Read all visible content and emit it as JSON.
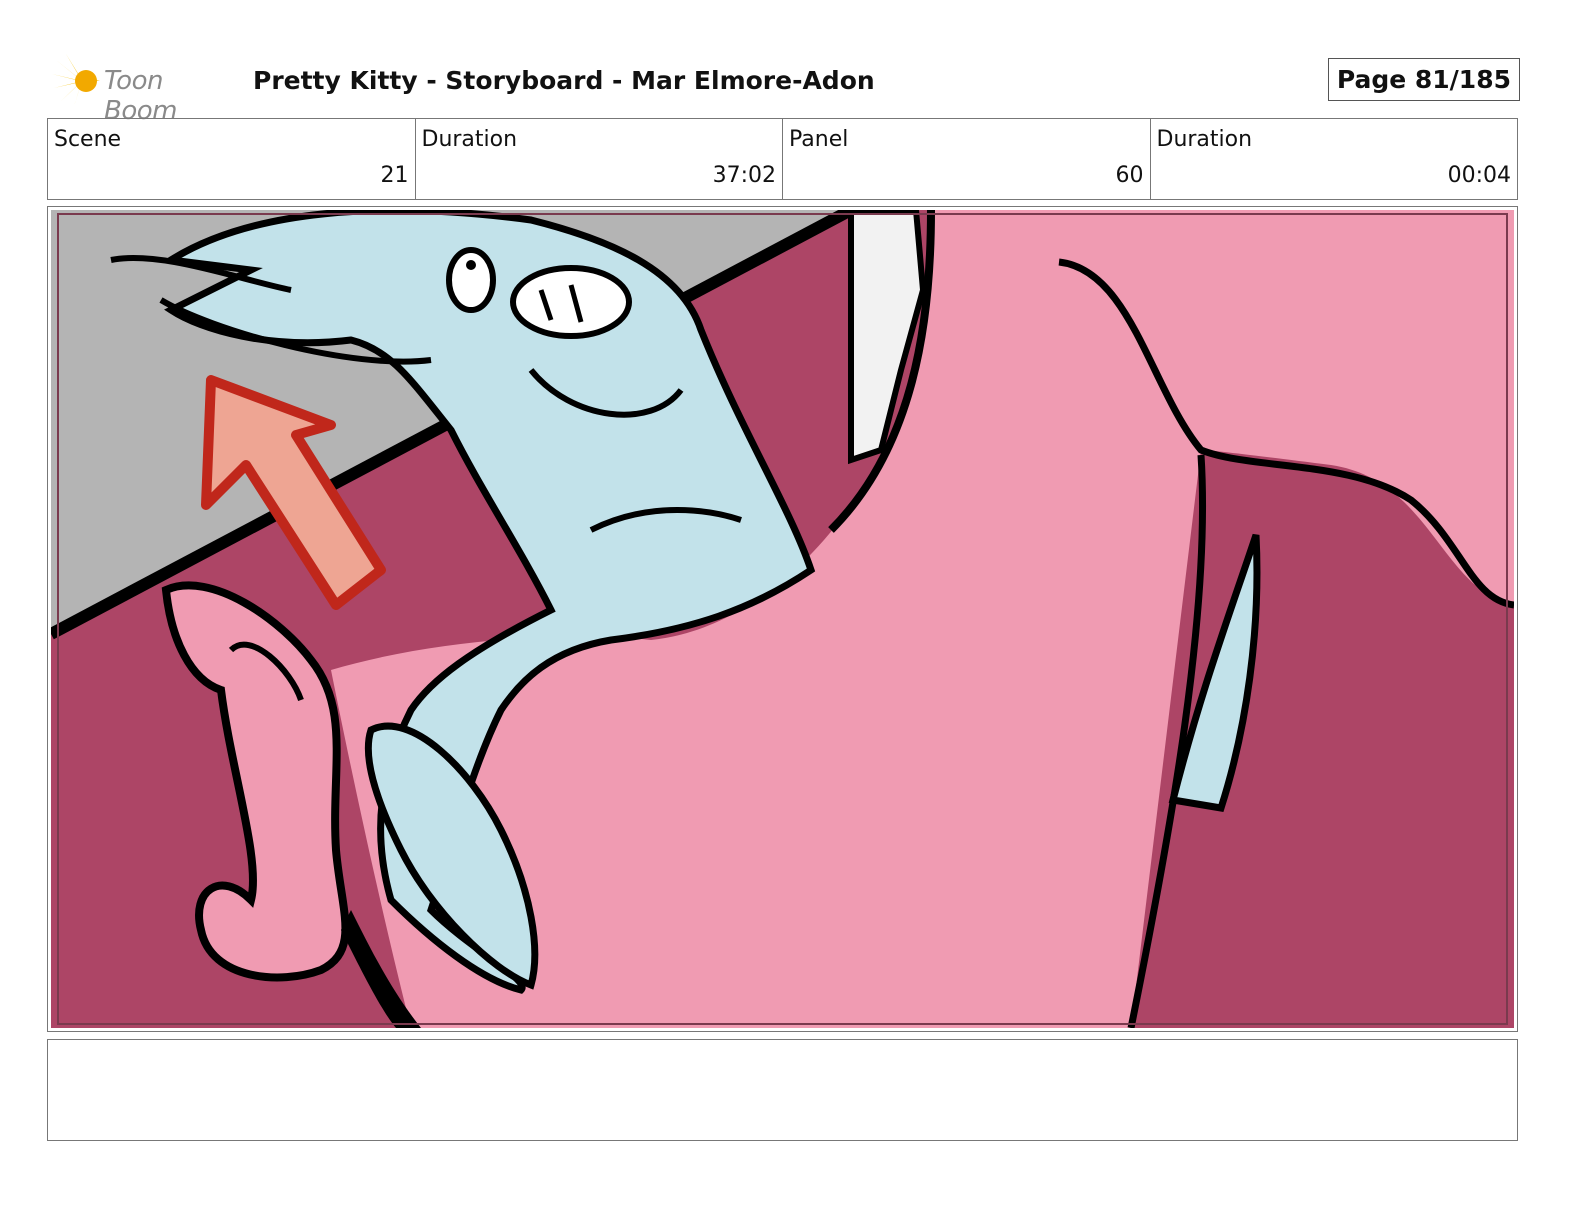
{
  "header": {
    "logo_text": "Toon Boom",
    "title": "Pretty Kitty - Storyboard - Mar Elmore-Adon",
    "page_label": "Page  81/185"
  },
  "info": [
    {
      "label": "Scene",
      "value": "21"
    },
    {
      "label": "Duration",
      "value": "37:02"
    },
    {
      "label": "Panel",
      "value": "60"
    },
    {
      "label": "Duration",
      "value": "00:04"
    }
  ],
  "colors": {
    "dark_pink": "#ad4566",
    "light_pink": "#f09bb2",
    "light_blue": "#c2e2ea",
    "gray": "#b4b4b4",
    "arrow_red": "#c0271b",
    "arrow_fill": "#eea593"
  },
  "notes": ""
}
